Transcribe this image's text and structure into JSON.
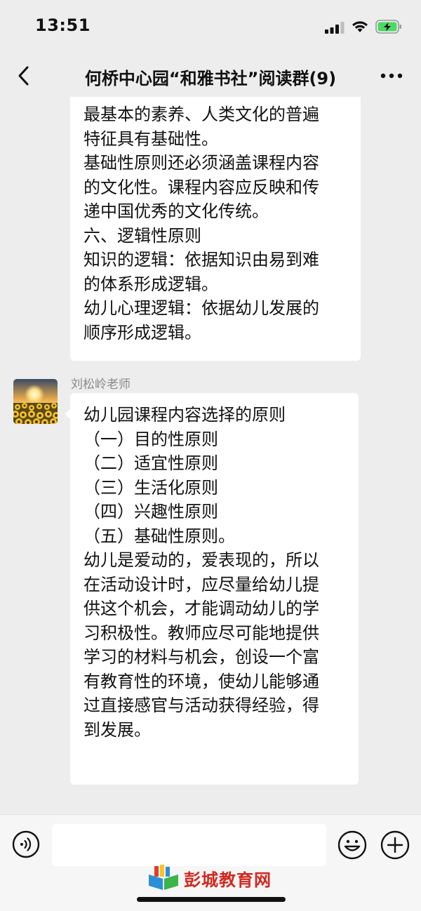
{
  "status_bar": {
    "time": "13:51"
  },
  "nav": {
    "title": "何桥中心园“和雅书社”阅读群(9)"
  },
  "messages": [
    {
      "lines": [
        "最基本的素养、人类文化的普遍",
        "特征具有基础性。",
        "基础性原则还必须涵盖课程内容",
        "的文化性。课程内容应反映和传",
        "递中国优秀的文化传统。",
        "六、逻辑性原则",
        "知识的逻辑：依据知识由易到难",
        "的体系形成逻辑。",
        "幼儿心理逻辑：依据幼儿发展的",
        "顺序形成逻辑。"
      ]
    },
    {
      "sender": "刘松岭老师",
      "lines": [
        "幼儿园课程内容选择的原则",
        "（一）目的性原则",
        "（二）适宜性原则",
        "（三）生活化原则",
        "（四）兴趣性原则",
        "（五）基础性原则。",
        "幼儿是爱动的，爱表现的，所以",
        "在活动设计时，应尽量给幼儿提",
        "供这个机会，才能调动幼儿的学",
        "习积极性。教师应尽可能地提供",
        "学习的材料与机会，创设一个富",
        "有教育性的环境，使幼儿能够通",
        "过直接感官与活动获得经验，得",
        "到发展。"
      ]
    }
  ],
  "input": {
    "value": ""
  },
  "watermark": {
    "text": "彭城教育网"
  },
  "icons": {
    "back": "chevron-left-icon",
    "more": "more-dots-icon",
    "voice": "voice-icon",
    "emoji": "emoji-icon",
    "plus": "plus-icon"
  },
  "colors": {
    "background": "#ededed",
    "bubble": "#ffffff",
    "battery_charge": "#4cd964",
    "watermark": "#d0291f"
  }
}
